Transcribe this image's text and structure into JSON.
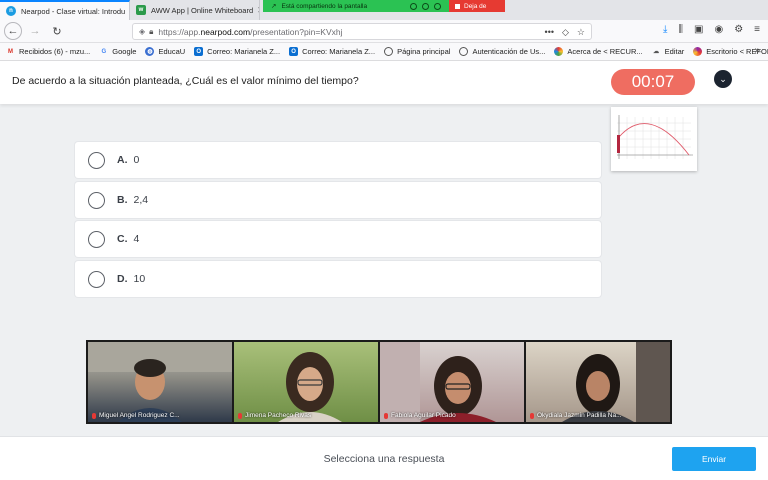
{
  "browser": {
    "tabs": [
      {
        "title": "Nearpod - Clase virtual: Introdu",
        "active": true,
        "favicon_color": "#1b9ce2"
      },
      {
        "title": "AWW App | Online Whiteboard",
        "active": false,
        "favicon_color": "#2b9a4a"
      }
    ],
    "sharing": {
      "label": "Está compartiendo la pantalla",
      "stop_label": "Deja de"
    },
    "url_prefix": "https://app.",
    "url_domain": "nearpod.com",
    "url_path": "/presentation?pin=KVxhj",
    "bookmarks": [
      {
        "label": "Recibidos (6) - mzu...",
        "icon": "gmail-icon",
        "color": "#d93025"
      },
      {
        "label": "Google",
        "icon": "google-icon",
        "color": "#4285f4"
      },
      {
        "label": "EducaU",
        "icon": "globe-icon",
        "color": "#3b6fd1"
      },
      {
        "label": "Correo: Marianela Z...",
        "icon": "outlook-icon",
        "color": "#0a6ed1"
      },
      {
        "label": "Correo: Marianela Z...",
        "icon": "outlook-icon",
        "color": "#0a6ed1"
      },
      {
        "label": "Página principal",
        "icon": "globe-icon",
        "color": "#555555"
      },
      {
        "label": "Autenticación de Us...",
        "icon": "globe-icon",
        "color": "#555555"
      },
      {
        "label": "Acerca de < RECUR...",
        "icon": "colorful-icon",
        "color": "#c2185b"
      },
      {
        "label": "Editar",
        "icon": "cloud-icon",
        "color": "#555555"
      },
      {
        "label": "Escritorio < REFOR...",
        "icon": "colorful-icon",
        "color": "#7b1fa2"
      }
    ]
  },
  "question": {
    "text": "De acuerdo a la situación planteada, ¿Cuál es el valor mínimo del tiempo?",
    "timer": "00:07"
  },
  "options": [
    {
      "letter": "A.",
      "value": "0"
    },
    {
      "letter": "B.",
      "value": "2,4"
    },
    {
      "letter": "C.",
      "value": "4"
    },
    {
      "letter": "D.",
      "value": "10"
    }
  ],
  "participants": [
    {
      "name": "Miguel Angel Rodriguez C...",
      "bg": "#8d8f8a"
    },
    {
      "name": "Jimena Pacheco Rivas",
      "bg": "#7fa05a"
    },
    {
      "name": "Fabiola Aguilar Picado",
      "bg": "#a88a8a"
    },
    {
      "name": "Okydiala Jazmin Padilla Na...",
      "bg": "#b9aa96"
    }
  ],
  "footer": {
    "prompt": "Selecciona una respuesta",
    "submit_label": "Enviar"
  },
  "colors": {
    "timer": "#ef6d61",
    "submit": "#1ea3f0"
  }
}
